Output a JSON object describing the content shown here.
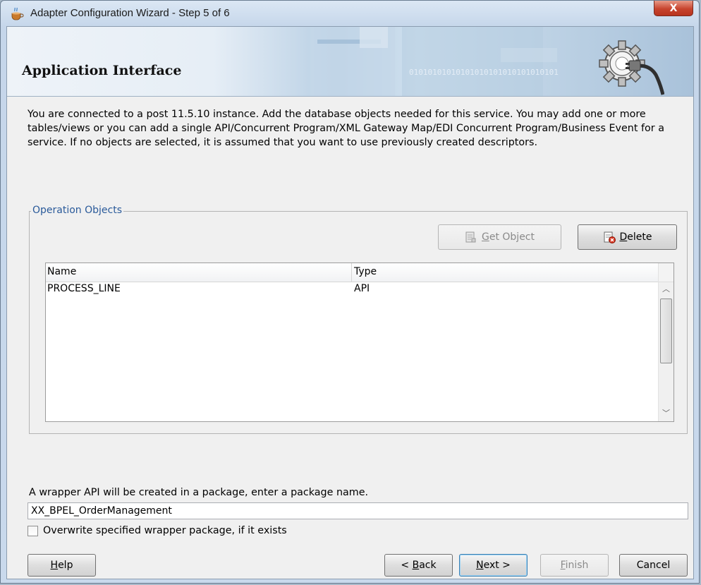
{
  "window": {
    "title": "Adapter Configuration Wizard - Step 5 of 6",
    "close_glyph": "X"
  },
  "banner": {
    "title": "Application Interface",
    "binary_text": "01010101010101010101010101010101",
    "icon": "gear-plug-icon"
  },
  "description": "You are connected to a post 11.5.10 instance. Add the database objects needed for this service. You may add one or more tables/views or you can add a single API/Concurrent Program/XML Gateway Map/EDI Concurrent Program/Business Event for a service. If no objects are selected, it is assumed that you want to use previously created descriptors.",
  "operation_objects": {
    "legend": "Operation Objects",
    "get_object": {
      "label": "Get Object",
      "mnemonic": "G",
      "rest": "et Object",
      "enabled": false
    },
    "delete": {
      "label": "Delete",
      "mnemonic": "D",
      "rest": "elete",
      "enabled": true
    },
    "table": {
      "columns": [
        "Name",
        "Type"
      ],
      "rows": [
        {
          "name": "PROCESS_LINE",
          "type": "API"
        }
      ]
    }
  },
  "wrapper": {
    "label": "A wrapper API will be created in a package, enter a package name.",
    "package_name": "XX_BPEL_OrderManagement",
    "overwrite_label": "Overwrite specified wrapper package, if it exists",
    "overwrite_checked": false
  },
  "footer": {
    "help": {
      "mnemonic": "H",
      "rest": "elp"
    },
    "back": {
      "prefix": "< ",
      "mnemonic": "B",
      "rest": "ack"
    },
    "next": {
      "mnemonic": "N",
      "rest": "ext >"
    },
    "finish": {
      "mnemonic": "F",
      "rest": "inish",
      "enabled": false
    },
    "cancel": {
      "label": "Cancel"
    }
  },
  "colors": {
    "legend": "#2a5a9a",
    "close_button": "#c7442e",
    "default_button_border": "#3c7fb1"
  }
}
